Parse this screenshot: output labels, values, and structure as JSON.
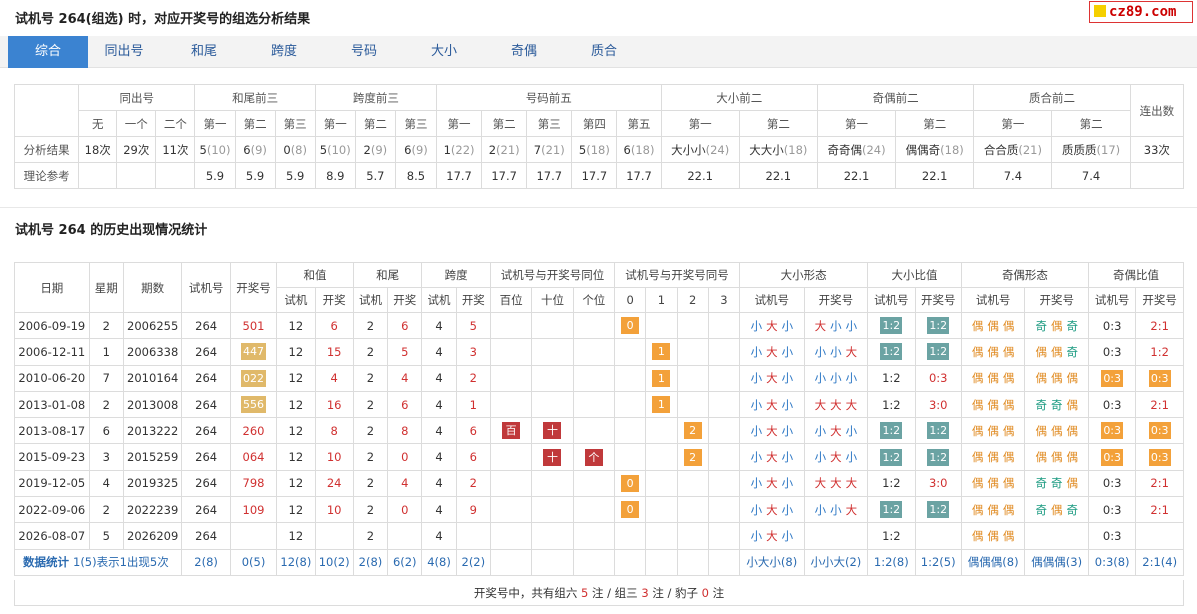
{
  "header": {
    "title": "试机号 264(组选) 时，对应开奖号的组选分析结果",
    "logo": "cz89.com"
  },
  "tabs": [
    "综合",
    "同出号",
    "和尾",
    "跨度",
    "号码",
    "大小",
    "奇偶",
    "质合"
  ],
  "analysis": {
    "groups": [
      "同出号",
      "和尾前三",
      "跨度前三",
      "号码前五",
      "大小前二",
      "奇偶前二",
      "质合前二",
      "连出数"
    ],
    "subheads": [
      "无",
      "一个",
      "二个",
      "第一",
      "第二",
      "第三",
      "第一",
      "第二",
      "第三",
      "第一",
      "第二",
      "第三",
      "第四",
      "第五",
      "第一",
      "第二",
      "第一",
      "第二",
      "第一",
      "第二"
    ],
    "row1_label": "分析结果",
    "row1": [
      [
        "18次",
        ""
      ],
      [
        "29次",
        ""
      ],
      [
        "11次",
        ""
      ],
      [
        "5",
        "(10)"
      ],
      [
        "6",
        "(9)"
      ],
      [
        "0",
        "(8)"
      ],
      [
        "5",
        "(10)"
      ],
      [
        "2",
        "(9)"
      ],
      [
        "6",
        "(9)"
      ],
      [
        "1",
        "(22)"
      ],
      [
        "2",
        "(21)"
      ],
      [
        "7",
        "(21)"
      ],
      [
        "5",
        "(18)"
      ],
      [
        "6",
        "(18)"
      ],
      [
        "大小小",
        "(24)"
      ],
      [
        "大大小",
        "(18)"
      ],
      [
        "奇奇偶",
        "(24)"
      ],
      [
        "偶偶奇",
        "(18)"
      ],
      [
        "合合质",
        "(21)"
      ],
      [
        "质质质",
        "(17)"
      ],
      [
        "33次",
        ""
      ]
    ],
    "row2_label": "理论参考",
    "row2": [
      "",
      "",
      "",
      "5.9",
      "5.9",
      "5.9",
      "8.9",
      "5.7",
      "8.5",
      "17.7",
      "17.7",
      "17.7",
      "17.7",
      "17.7",
      "22.1",
      "22.1",
      "22.1",
      "22.1",
      "7.4",
      "7.4",
      ""
    ]
  },
  "history": {
    "title": "试机号 264 的历史出现情况统计",
    "head1": [
      "日期",
      "星期",
      "期数",
      "试机号",
      "开奖号",
      "和值",
      "和尾",
      "跨度",
      "试机号与开奖号同位",
      "试机号与开奖号同号",
      "大小形态",
      "大小比值",
      "奇偶形态",
      "奇偶比值"
    ],
    "head2": [
      "试机",
      "开奖",
      "试机",
      "开奖",
      "试机",
      "开奖",
      "百位",
      "十位",
      "个位",
      "0",
      "1",
      "2",
      "3",
      "试机号",
      "开奖号",
      "试机号",
      "开奖号",
      "试机号",
      "开奖号",
      "试机号",
      "开奖号"
    ],
    "rows": [
      {
        "date": "2006-09-19",
        "week": "2",
        "issue": "2006255",
        "test": "264",
        "draw": "501",
        "drawbox": false,
        "s1": "12",
        "s2": "6",
        "w1": "2",
        "w2": "6",
        "k1": "4",
        "k2": "5",
        "p": [
          "",
          "",
          ""
        ],
        "same": [
          0,
          "0"
        ],
        "bs1": [
          "小",
          "大",
          "小"
        ],
        "bs2": [
          "大",
          "小",
          "小"
        ],
        "br1": "1:2",
        "br1b": true,
        "br2": "1:2",
        "br2b": true,
        "oe1": [
          "偶",
          "偶",
          "偶"
        ],
        "oe2": [
          "奇",
          "偶",
          "奇"
        ],
        "or1": "0:3",
        "or1b": false,
        "or2": "2:1",
        "or2b": false
      },
      {
        "date": "2006-12-11",
        "week": "1",
        "issue": "2006338",
        "test": "264",
        "draw": "447",
        "drawbox": true,
        "s1": "12",
        "s2": "15",
        "w1": "2",
        "w2": "5",
        "k1": "4",
        "k2": "3",
        "p": [
          "",
          "",
          ""
        ],
        "same": [
          1,
          "1"
        ],
        "bs1": [
          "小",
          "大",
          "小"
        ],
        "bs2": [
          "小",
          "小",
          "大"
        ],
        "br1": "1:2",
        "br1b": true,
        "br2": "1:2",
        "br2b": true,
        "oe1": [
          "偶",
          "偶",
          "偶"
        ],
        "oe2": [
          "偶",
          "偶",
          "奇"
        ],
        "or1": "0:3",
        "or1b": false,
        "or2": "1:2",
        "or2b": false
      },
      {
        "date": "2010-06-20",
        "week": "7",
        "issue": "2010164",
        "test": "264",
        "draw": "022",
        "drawbox": true,
        "s1": "12",
        "s2": "4",
        "w1": "2",
        "w2": "4",
        "k1": "4",
        "k2": "2",
        "p": [
          "",
          "",
          ""
        ],
        "same": [
          1,
          "1"
        ],
        "bs1": [
          "小",
          "大",
          "小"
        ],
        "bs2": [
          "小",
          "小",
          "小"
        ],
        "br1": "1:2",
        "br1b": false,
        "br2": "0:3",
        "br2b": false,
        "oe1": [
          "偶",
          "偶",
          "偶"
        ],
        "oe2": [
          "偶",
          "偶",
          "偶"
        ],
        "or1": "0:3",
        "or1b": true,
        "or2": "0:3",
        "or2b": true
      },
      {
        "date": "2013-01-08",
        "week": "2",
        "issue": "2013008",
        "test": "264",
        "draw": "556",
        "drawbox": true,
        "s1": "12",
        "s2": "16",
        "w1": "2",
        "w2": "6",
        "k1": "4",
        "k2": "1",
        "p": [
          "",
          "",
          ""
        ],
        "same": [
          1,
          "1"
        ],
        "bs1": [
          "小",
          "大",
          "小"
        ],
        "bs2": [
          "大",
          "大",
          "大"
        ],
        "br1": "1:2",
        "br1b": false,
        "br2": "3:0",
        "br2b": false,
        "oe1": [
          "偶",
          "偶",
          "偶"
        ],
        "oe2": [
          "奇",
          "奇",
          "偶"
        ],
        "or1": "0:3",
        "or1b": false,
        "or2": "2:1",
        "or2b": false
      },
      {
        "date": "2013-08-17",
        "week": "6",
        "issue": "2013222",
        "test": "264",
        "draw": "260",
        "drawbox": false,
        "s1": "12",
        "s2": "8",
        "w1": "2",
        "w2": "8",
        "k1": "4",
        "k2": "6",
        "p": [
          "百",
          "十",
          ""
        ],
        "same": [
          2,
          "2"
        ],
        "bs1": [
          "小",
          "大",
          "小"
        ],
        "bs2": [
          "小",
          "大",
          "小"
        ],
        "br1": "1:2",
        "br1b": true,
        "br2": "1:2",
        "br2b": true,
        "oe1": [
          "偶",
          "偶",
          "偶"
        ],
        "oe2": [
          "偶",
          "偶",
          "偶"
        ],
        "or1": "0:3",
        "or1b": true,
        "or2": "0:3",
        "or2b": true
      },
      {
        "date": "2015-09-23",
        "week": "3",
        "issue": "2015259",
        "test": "264",
        "draw": "064",
        "drawbox": false,
        "s1": "12",
        "s2": "10",
        "w1": "2",
        "w2": "0",
        "k1": "4",
        "k2": "6",
        "p": [
          "",
          "十",
          "个"
        ],
        "same": [
          2,
          "2"
        ],
        "bs1": [
          "小",
          "大",
          "小"
        ],
        "bs2": [
          "小",
          "大",
          "小"
        ],
        "br1": "1:2",
        "br1b": true,
        "br2": "1:2",
        "br2b": true,
        "oe1": [
          "偶",
          "偶",
          "偶"
        ],
        "oe2": [
          "偶",
          "偶",
          "偶"
        ],
        "or1": "0:3",
        "or1b": true,
        "or2": "0:3",
        "or2b": true
      },
      {
        "date": "2019-12-05",
        "week": "4",
        "issue": "2019325",
        "test": "264",
        "draw": "798",
        "drawbox": false,
        "s1": "12",
        "s2": "24",
        "w1": "2",
        "w2": "4",
        "k1": "4",
        "k2": "2",
        "p": [
          "",
          "",
          ""
        ],
        "same": [
          0,
          "0"
        ],
        "bs1": [
          "小",
          "大",
          "小"
        ],
        "bs2": [
          "大",
          "大",
          "大"
        ],
        "br1": "1:2",
        "br1b": false,
        "br2": "3:0",
        "br2b": false,
        "oe1": [
          "偶",
          "偶",
          "偶"
        ],
        "oe2": [
          "奇",
          "奇",
          "偶"
        ],
        "or1": "0:3",
        "or1b": false,
        "or2": "2:1",
        "or2b": false
      },
      {
        "date": "2022-09-06",
        "week": "2",
        "issue": "2022239",
        "test": "264",
        "draw": "109",
        "drawbox": false,
        "s1": "12",
        "s2": "10",
        "w1": "2",
        "w2": "0",
        "k1": "4",
        "k2": "9",
        "p": [
          "",
          "",
          ""
        ],
        "same": [
          0,
          "0"
        ],
        "bs1": [
          "小",
          "大",
          "小"
        ],
        "bs2": [
          "小",
          "小",
          "大"
        ],
        "br1": "1:2",
        "br1b": true,
        "br2": "1:2",
        "br2b": true,
        "oe1": [
          "偶",
          "偶",
          "偶"
        ],
        "oe2": [
          "奇",
          "偶",
          "奇"
        ],
        "or1": "0:3",
        "or1b": false,
        "or2": "2:1",
        "or2b": false
      },
      {
        "date": "2026-08-07",
        "week": "5",
        "issue": "2026209",
        "test": "264",
        "draw": "",
        "drawbox": false,
        "s1": "12",
        "s2": "",
        "w1": "2",
        "w2": "",
        "k1": "4",
        "k2": "",
        "p": [
          "",
          "",
          ""
        ],
        "same": [
          -1,
          ""
        ],
        "bs1": [
          "小",
          "大",
          "小"
        ],
        "bs2": [
          "",
          "",
          ""
        ],
        "br1": "1:2",
        "br1b": false,
        "br2": "",
        "br2b": false,
        "oe1": [
          "偶",
          "偶",
          "偶"
        ],
        "oe2": [
          "",
          "",
          ""
        ],
        "or1": "0:3",
        "or1b": false,
        "or2": "",
        "or2b": false
      }
    ],
    "stats_label": "数据统计",
    "stats_note": "1(5)表示1出现5次",
    "stats": [
      "2(8)",
      "0(5)",
      "12(8)",
      "10(2)",
      "2(8)",
      "6(2)",
      "4(8)",
      "2(2)",
      "",
      "",
      "",
      "",
      "",
      "",
      "",
      "小大小(8)",
      "小小大(2)",
      "1:2(8)",
      "1:2(5)",
      "偶偶偶(8)",
      "偶偶偶(3)",
      "0:3(8)",
      "2:1(4)"
    ],
    "summary": {
      "prefix": "开奖号中，共有组六",
      "n6": "5",
      "mid1": "注 / 组三",
      "n3": "3",
      "mid2": "注 / 豹子",
      "nb": "0",
      "suffix": "注"
    }
  },
  "colors": {
    "accent": "#3b83d1",
    "small": "#2b76c4",
    "big": "#d03030",
    "even": "#e08a20",
    "odd": "#1a9a80",
    "badge_orange": "#f3a13a",
    "badge_teal": "#6ba3a3",
    "badge_red": "#c0393b"
  }
}
